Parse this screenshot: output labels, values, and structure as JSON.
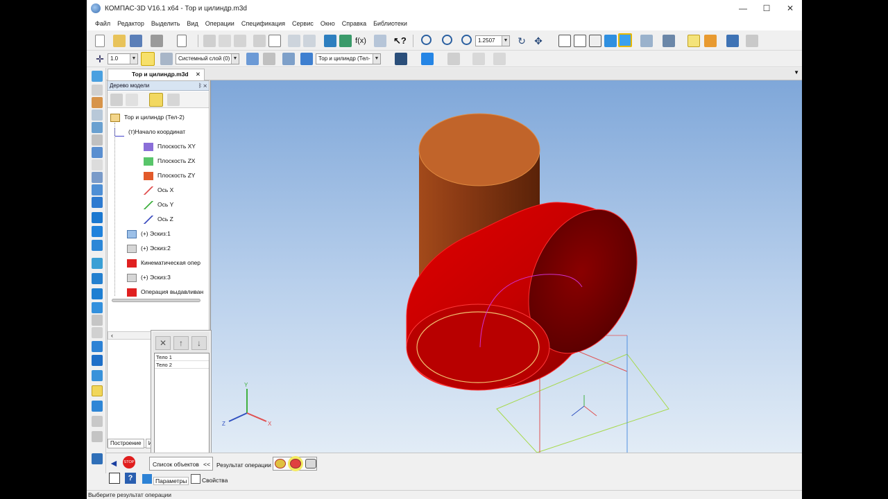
{
  "window": {
    "title": "КОМПАС-3D V16.1 x64 - Тор и цилиндр.m3d",
    "minimize": "—",
    "maximize": "☐",
    "close": "✕"
  },
  "menu": {
    "items": [
      "Файл",
      "Редактор",
      "Выделить",
      "Вид",
      "Операции",
      "Спецификация",
      "Сервис",
      "Окно",
      "Справка",
      "Библиотеки"
    ]
  },
  "toolbar": {
    "scale_value": "1.2507",
    "step_value": "1.0",
    "layer_value": "Системный слой (0)",
    "body_value": "Тор и цилиндр (Тел-"
  },
  "document": {
    "tab_label": "Тор и цилиндр.m3d",
    "tab_close": "✕"
  },
  "model_tree": {
    "header": "Дерево модели",
    "header_pins": "ᛒ ✕",
    "nodes": [
      {
        "label": "Тор и цилиндр (Тел-2)",
        "icon": "part-icon"
      },
      {
        "label": "(т)Начало координат",
        "icon": "origin-icon"
      },
      {
        "label": "Плоскость XY",
        "icon": "plane-xy-icon"
      },
      {
        "label": "Плоскость ZX",
        "icon": "plane-zx-icon"
      },
      {
        "label": "Плоскость ZY",
        "icon": "plane-zy-icon"
      },
      {
        "label": "Ось X",
        "icon": "axis-x-icon"
      },
      {
        "label": "Ось Y",
        "icon": "axis-y-icon"
      },
      {
        "label": "Ось Z",
        "icon": "axis-z-icon"
      },
      {
        "label": "(+) Эскиз:1",
        "icon": "sketch-icon"
      },
      {
        "label": "(+) Эскиз:2",
        "icon": "sketch-icon"
      },
      {
        "label": "Кинематическая опер",
        "icon": "sweep-icon"
      },
      {
        "label": "(+) Эскиз:3",
        "icon": "sketch-icon"
      },
      {
        "label": "Операция выдавливан",
        "icon": "extrude-icon"
      }
    ],
    "bottom_tab": "Построение",
    "bottom_tab2": "И",
    "scroll_left": "‹"
  },
  "objects_panel": {
    "items": [
      "Тело 1",
      "Тело 2"
    ]
  },
  "property_bar": {
    "objects_list_label": "Список объектов",
    "collapse": "<<",
    "result_label": "Результат операции",
    "params_tab": "Параметры",
    "props_tab": "Свойства",
    "stop_label": "STOP"
  },
  "status": {
    "text": "Выберите результат операции"
  },
  "axes": {
    "x": "X",
    "y": "Y",
    "z": "Z"
  },
  "colors": {
    "cylinder": "#c1642a",
    "torus": "#d20000",
    "viewport_top": "#7fa7d9"
  }
}
